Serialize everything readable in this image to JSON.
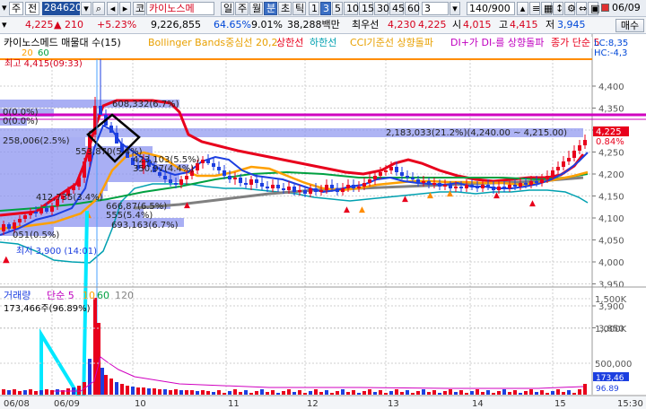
{
  "toolbar": {
    "tab_label": "주",
    "side_label": "전",
    "code": "284620",
    "stock_name": "카이노스메",
    "period_buttons": [
      "일",
      "주",
      "월",
      "분",
      "초",
      "틱"
    ],
    "active_period": "분",
    "minute_options": [
      "1",
      "3",
      "5",
      "10",
      "15",
      "30",
      "45",
      "60"
    ],
    "active_minute": "3",
    "interval_value": "3",
    "count_display": "140/900",
    "buy_button": "매수",
    "date_display": "06/09"
  },
  "quote": {
    "price": "4,225",
    "change_arrow": "▲",
    "change": "210",
    "change_pct": "+5.23%",
    "volume": "9,226,855",
    "ratio1": "64.65%",
    "ratio2": "9.01%",
    "amount": "38,288백만",
    "best_label": "최우선",
    "best_ask": "4,230",
    "best_bid": "4,225",
    "open_label": "시",
    "open": "4,015",
    "high_label": "고",
    "high": "4,415",
    "low_label": "저",
    "low": "3,945",
    "buy_button2": "매수"
  },
  "indicators": {
    "ma_label": "카이노스메드 매물대 수(15)",
    "bb_label": "Bollinger Bands중심선 20,2",
    "upper_label": "상한선",
    "lower_label": "하한선",
    "cci_label": "CCI기준선 상향돌파",
    "di_label": "DI+가 DI-를 상향돌파",
    "close_label": "종가 단순 5",
    "ma_periods": [
      "20",
      "60"
    ],
    "lc_label": "LC:8,35",
    "hc_label": "HC:-4,3"
  },
  "annotations": {
    "high_mark": "최고 4,415(09:33)",
    "low_mark": "최저 3,900 (14:01)",
    "zone_labels": [
      "608,332(6.7%)",
      "0(0.0%)",
      "0(0.0%)",
      "258,006(2.5%)",
      "2,183,033(21.2%)(4,240.00 ~ 4,215.00)",
      "553,870(5.4%)",
      "423,103(5.5%)",
      "350,97(4.4%)",
      "412,735(3.4%)",
      "666,87(6.5%)",
      "555(5.4%)",
      "693,163(6.7%)",
      "051(0.5%)"
    ],
    "current_price_tag": "4,225",
    "current_pct_tag": "0.84%"
  },
  "price_axis": [
    "4,400",
    "4,350",
    "4,300",
    "4,250",
    "4,200",
    "4,150",
    "4,100",
    "4,050",
    "4,000",
    "3,950",
    "3,900",
    "3,850"
  ],
  "volume_panel": {
    "label": "거래량",
    "ma_label": "단순 5",
    "ma_periods": [
      "10",
      "60",
      "120"
    ],
    "current_volume": "173,466주(96.89%)",
    "axis": [
      "1,500K",
      "1,000K",
      "500,000"
    ],
    "right_tag1": "173,46",
    "right_tag2": "96.89"
  },
  "time_axis": [
    "06/08",
    "06/09",
    "10",
    "11",
    "12",
    "13",
    "14",
    "15",
    "15:30"
  ],
  "colors": {
    "up": "#e8001c",
    "down": "#1c3fe0",
    "upper_band": "#e8001c",
    "lower_band": "#00a0b0",
    "ma20": "#ffa000",
    "ma60": "#00a040",
    "ma_long": "#808080",
    "zone": "#8c94f0",
    "magenta_line": "#d000c0",
    "cyan_drawing": "#00e8ff"
  }
}
